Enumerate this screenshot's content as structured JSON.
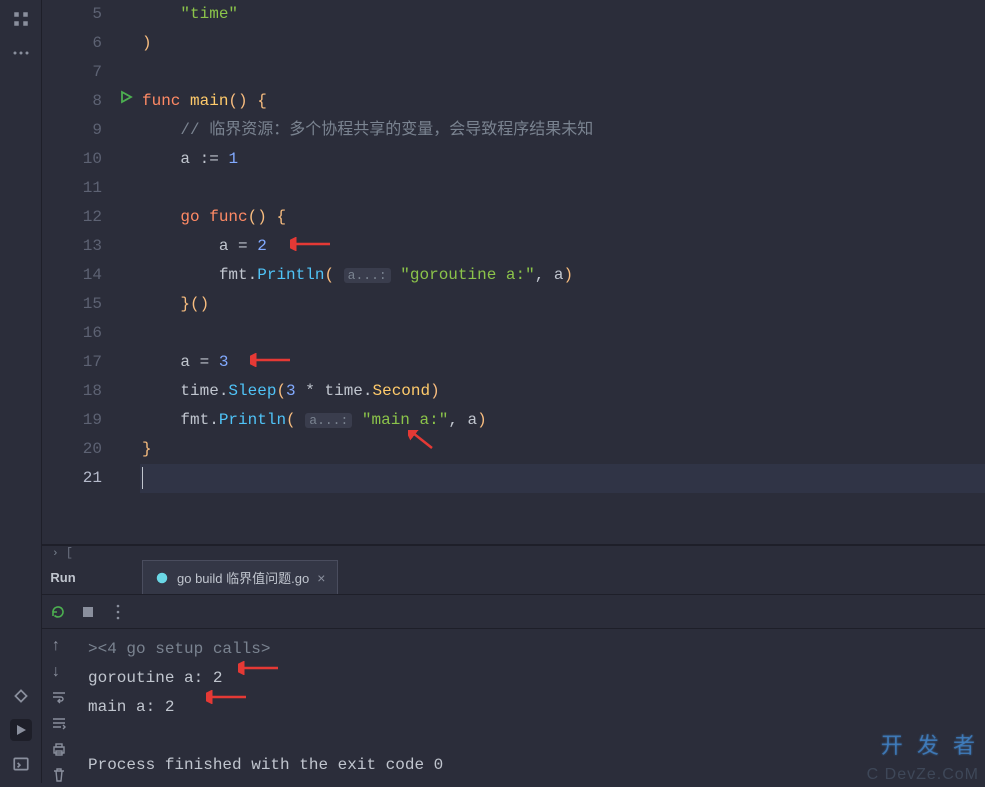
{
  "editor": {
    "line_start": 5,
    "active_line": 21,
    "run_marker_line": 8,
    "code": {
      "l5": {
        "str": "\"time\""
      },
      "l6": {
        "paren": ")"
      },
      "l8": {
        "kw": "func",
        "name": "main",
        "parens": "()",
        "brace": "{"
      },
      "l9": {
        "comment": "// 临界资源：多个协程共享的变量，会导致程序结果未知"
      },
      "l10": {
        "var": "a",
        "op": ":=",
        "num": "1"
      },
      "l12": {
        "kw": "go",
        "kw2": "func",
        "parens": "()",
        "brace": "{"
      },
      "l13": {
        "var": "a",
        "op": "=",
        "num": "2"
      },
      "l14": {
        "pkg": "fmt",
        "fn": "Println",
        "hint": "a...:",
        "str": "\"goroutine a:\"",
        "var": "a"
      },
      "l15": {
        "brace": "}",
        "parens": "()"
      },
      "l17": {
        "var": "a",
        "op": "=",
        "num": "3"
      },
      "l18": {
        "pkg": "time",
        "fn": "Sleep",
        "num1": "3",
        "op": "*",
        "pkg2": "time",
        "const": "Second"
      },
      "l19": {
        "pkg": "fmt",
        "fn": "Println",
        "hint": "a...:",
        "str": "\"main a:\"",
        "var": "a"
      },
      "l20": {
        "brace": "}"
      }
    }
  },
  "terminal": {
    "run_label": "Run",
    "tab_label": "go build 临界值问题.go",
    "output": {
      "setup": "<4 go setup calls>",
      "line1": "goroutine a: 2",
      "line2": "main a: 2",
      "exit": "Process finished with the exit code 0"
    }
  },
  "watermark": {
    "main": "开 发 者",
    "sub": "C DevZe.CoM"
  }
}
